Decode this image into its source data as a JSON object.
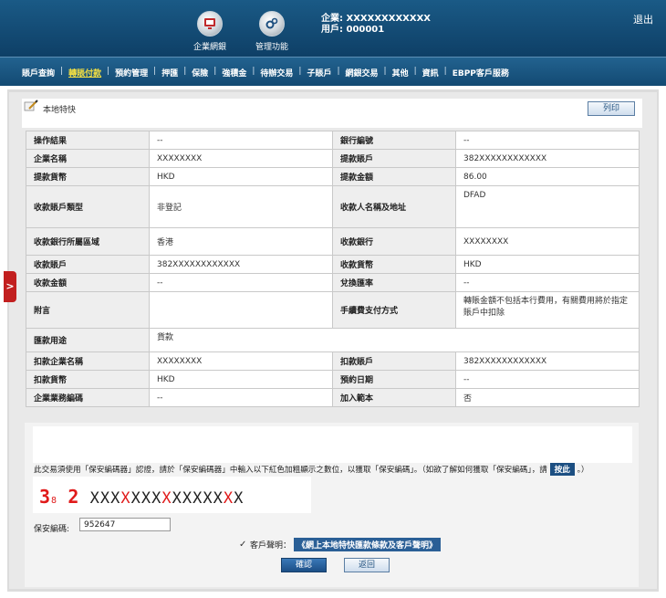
{
  "header": {
    "company_label": "企業: XXXXXXXXXXXX",
    "user_label": "用戶: 000001",
    "logout": "退出",
    "nav": [
      {
        "label": "企業網銀",
        "icon": "monitor-icon"
      },
      {
        "label": "管理功能",
        "icon": "gears-icon"
      }
    ]
  },
  "menu": {
    "items": [
      "賬戶查詢",
      "轉賬付款",
      "預約管理",
      "押匯",
      "保險",
      "強積金",
      "待辦交易",
      "子賬戶",
      "網銀交易",
      "其他",
      "資訊",
      "EBPP客戶服務"
    ],
    "active": "轉賬付款"
  },
  "page": {
    "title": "本地特快",
    "print": "列印"
  },
  "details": {
    "rows": [
      {
        "k1": "操作結果",
        "v1": "--",
        "k2": "銀行編號",
        "v2": "--"
      },
      {
        "k1": "企業名稱",
        "v1": "XXXXXXXX",
        "k2": "提款賬戶",
        "v2": "382XXXXXXXXXXXX"
      },
      {
        "k1": "提款貨幣",
        "v1": "HKD",
        "k2": "提款金額",
        "v2": "86.00"
      },
      {
        "k1": "收款賬戶類型",
        "v1": "非登記",
        "k2": "收款人名稱及地址",
        "v2": "DFAD"
      },
      {
        "k1": "收款銀行所屬區域",
        "v1": "香港",
        "k2": "收款銀行",
        "v2": "XXXXXXXX"
      },
      {
        "k1": "收款賬戶",
        "v1": "382XXXXXXXXXXXX",
        "k2": "收款貨幣",
        "v2": "HKD"
      },
      {
        "k1": "收款金額",
        "v1": "--",
        "k2": "兌換匯率",
        "v2": "--"
      },
      {
        "k1": "附言",
        "v1": "",
        "k2": "手續費支付方式",
        "v2": "轉賬金額不包括本行費用，有關費用將於指定賬戶中扣除"
      },
      {
        "k1": "匯款用途",
        "v1": "貨款"
      },
      {
        "k1": "扣款企業名稱",
        "v1": "XXXXXXXX",
        "k2": "扣款賬戶",
        "v2": "382XXXXXXXXXXXX"
      },
      {
        "k1": "扣款貨幣",
        "v1": "HKD",
        "k2": "預約日期",
        "v2": "--"
      },
      {
        "k1": "企業業務編碼",
        "v1": "--",
        "k2": "加入範本",
        "v2": "否"
      }
    ]
  },
  "security": {
    "instruction": "此交易須使用「保安編碼器」認證，請於「保安編碼器」中輸入以下紅色加粗顯示之數位，以獲取「保安編碼」。（如欲了解如何獲取「保安編碼」，請",
    "press_here": "按此",
    "instruction_end": "。）",
    "code_prefix_a": "3",
    "code_prefix_sub": "8",
    "code_prefix_b": "2",
    "code_chars": [
      "X",
      "X",
      "X",
      "X",
      "X",
      "X",
      "X",
      "X",
      "X",
      "X",
      "X",
      "X",
      "X",
      "X",
      "X"
    ],
    "code_red_flags": [
      0,
      0,
      0,
      1,
      0,
      0,
      0,
      1,
      0,
      0,
      0,
      0,
      0,
      1,
      0
    ],
    "password_label": "保安編碼:",
    "password_value": "952647",
    "declaration_label": "客戶聲明：",
    "declaration_link": "《網上本地特快匯款條款及客戶聲明》",
    "declaration_checked": true,
    "confirm": "確認",
    "back": "返回"
  },
  "side_tab": ">",
  "colors": {
    "header": "#0e3f66",
    "menu": "#134a73",
    "active_menu": "#f5e042",
    "code_red": "#e01a1a"
  }
}
